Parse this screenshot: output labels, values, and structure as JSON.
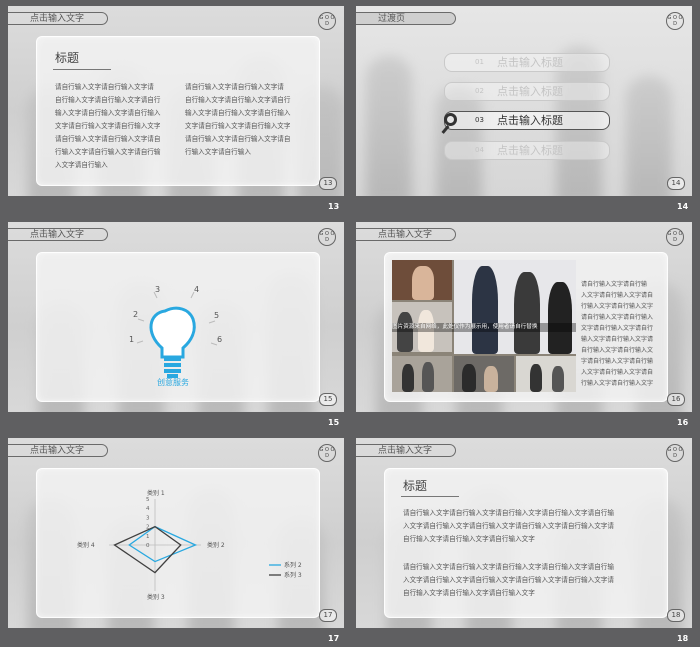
{
  "slides": [
    {
      "number": "13",
      "header": "点击输入文字",
      "page_label": "13",
      "title": "标题",
      "col1": [
        "请自行输入文字请自行输入文字请",
        "自行输入文字请自行输入文字请自行",
        "输入文字请自行输入文字请自行输入",
        "文字请自行输入文字请自行输入文字",
        "请自行输入文字请自行输入文字请自",
        "行输入文字请自行输入文字请自行输",
        "入文字请自行输入"
      ],
      "col2": [
        "请自行输入文字请自行输入文字请",
        "自行输入文字请自行输入文字请自行",
        "输入文字请自行输入文字请自行输入",
        "文字请自行输入文字请自行输入文字",
        "请自行输入文字请自行输入文字请自",
        "行输入文字请自行输入"
      ]
    },
    {
      "number": "14",
      "header": "过渡页",
      "page_label": "14",
      "items": [
        {
          "n": "01",
          "t": "点击输入标题"
        },
        {
          "n": "02",
          "t": "点击输入标题"
        },
        {
          "n": "03",
          "t": "点击输入标题"
        },
        {
          "n": "04",
          "t": "点击输入标题"
        }
      ]
    },
    {
      "number": "15",
      "header": "点击输入文字",
      "page_label": "15",
      "caption": "创意服务",
      "ticks": [
        "1",
        "2",
        "3",
        "4",
        "5",
        "6"
      ]
    },
    {
      "number": "16",
      "header": "点击输入文字",
      "page_label": "16",
      "photo_caption": "图片资源来自网络，此处仅作为展示用，使用者请自行替换",
      "text": [
        "请自行输入文字请自行输",
        "入文字请自行输入文字请自",
        "行输入文字请自行输入文字",
        "请自行输入文字请自行输入",
        "文字请自行输入文字请自行",
        "输入文字请自行输入文字请",
        "自行输入文字请自行输入文",
        "字请自行输入文字请自行输",
        "入文字请自行输入文字请自",
        "行输入文字请自行输入文字"
      ]
    },
    {
      "number": "17",
      "header": "点击输入文字",
      "page_label": "17"
    },
    {
      "number": "18",
      "header": "点击输入文字",
      "page_label": "18",
      "title": "标题",
      "para1": [
        "请自行输入文字请自行输入文字请自行输入文字请自行输入文字请自行输",
        "入文字请自行输入文字请自行输入文字请自行输入文字请自行输入文字请",
        "自行输入文字请自行输入文字请自行输入文字"
      ],
      "para2": [
        "请自行输入文字请自行输入文字请自行输入文字请自行输入文字请自行输",
        "入文字请自行输入文字请自行输入文字请自行输入文字请自行输入文字请",
        "自行输入文字请自行输入文字请自行输入文字"
      ]
    }
  ],
  "logo_text": "G O O D",
  "chart_data": {
    "type": "radar",
    "categories": [
      "类别 1",
      "类别 2",
      "类别 3",
      "类别 4"
    ],
    "ticks": [
      "5",
      "4",
      "3",
      "2",
      "1",
      "0"
    ],
    "rmax": 5,
    "series": [
      {
        "name": "系列 2",
        "color": "#29a8e0",
        "values": [
          2,
          4.4,
          1.8,
          2.8
        ]
      },
      {
        "name": "系列 3",
        "color": "#404040",
        "values": [
          2,
          2.8,
          3,
          4.4
        ]
      }
    ]
  }
}
